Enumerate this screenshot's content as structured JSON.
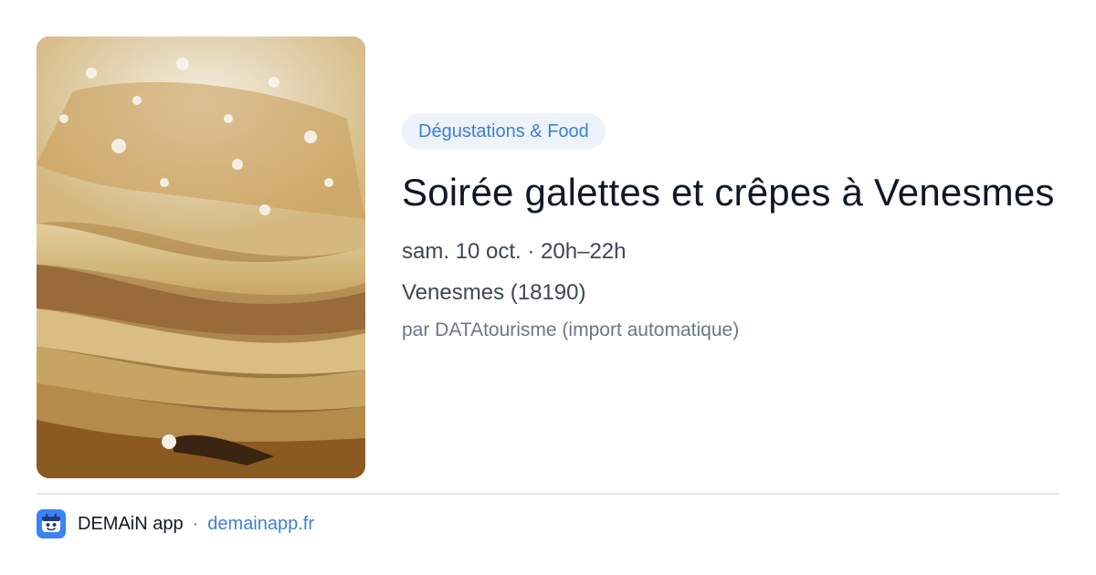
{
  "event": {
    "category": "Dégustations & Food",
    "title": "Soirée galettes et crêpes à Venesmes",
    "datetime": "sam. 10 oct. · 20h–22h",
    "location": "Venesmes (18190)",
    "source": "par DATAtourisme (import automatique)",
    "image_icon": "photo-crepes-stack"
  },
  "footer": {
    "app_icon": "demain-app-icon",
    "brand": "DEMAiN app",
    "separator": "·",
    "site": "demainapp.fr"
  },
  "colors": {
    "accent": "#3b7fd4",
    "badge_bg": "#eef3fb",
    "title": "#0f1729",
    "text": "#3c4656",
    "muted": "#6b7687",
    "app_icon_bg": "#3b82f6"
  }
}
